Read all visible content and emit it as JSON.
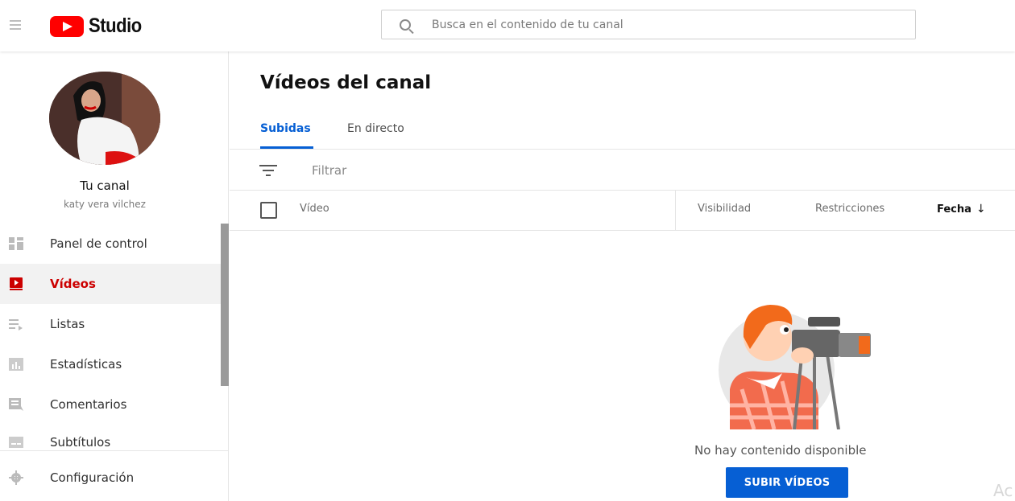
{
  "header": {
    "app_name": "Studio",
    "search_placeholder": "Busca en el contenido de tu canal"
  },
  "sidebar": {
    "channel_title": "Tu canal",
    "channel_name": "katy vera vilchez",
    "items": [
      {
        "label": "Panel de control",
        "icon": "dashboard-icon",
        "active": false
      },
      {
        "label": "Vídeos",
        "icon": "video-icon",
        "active": true
      },
      {
        "label": "Listas",
        "icon": "playlist-icon",
        "active": false
      },
      {
        "label": "Estadísticas",
        "icon": "analytics-icon",
        "active": false
      },
      {
        "label": "Comentarios",
        "icon": "comments-icon",
        "active": false
      },
      {
        "label": "Subtítulos",
        "icon": "subtitles-icon",
        "active": false
      },
      {
        "label": "Configuración",
        "icon": "settings-gear-icon",
        "active": false
      }
    ]
  },
  "main": {
    "title": "Vídeos del canal",
    "tabs": [
      {
        "label": "Subidas",
        "active": true
      },
      {
        "label": "En directo",
        "active": false
      }
    ],
    "filter_placeholder": "Filtrar",
    "columns": {
      "video": "Vídeo",
      "visibility": "Visibilidad",
      "restrictions": "Restricciones",
      "date": "Fecha",
      "date_sort_icon": "↓"
    },
    "empty_state": {
      "message": "No hay contenido disponible",
      "button": "SUBIR VÍDEOS"
    }
  },
  "overlay_text": "Ac",
  "colors": {
    "brand_red": "#ff0000",
    "active_nav": "#cc0000",
    "accent_blue": "#065fd4"
  }
}
